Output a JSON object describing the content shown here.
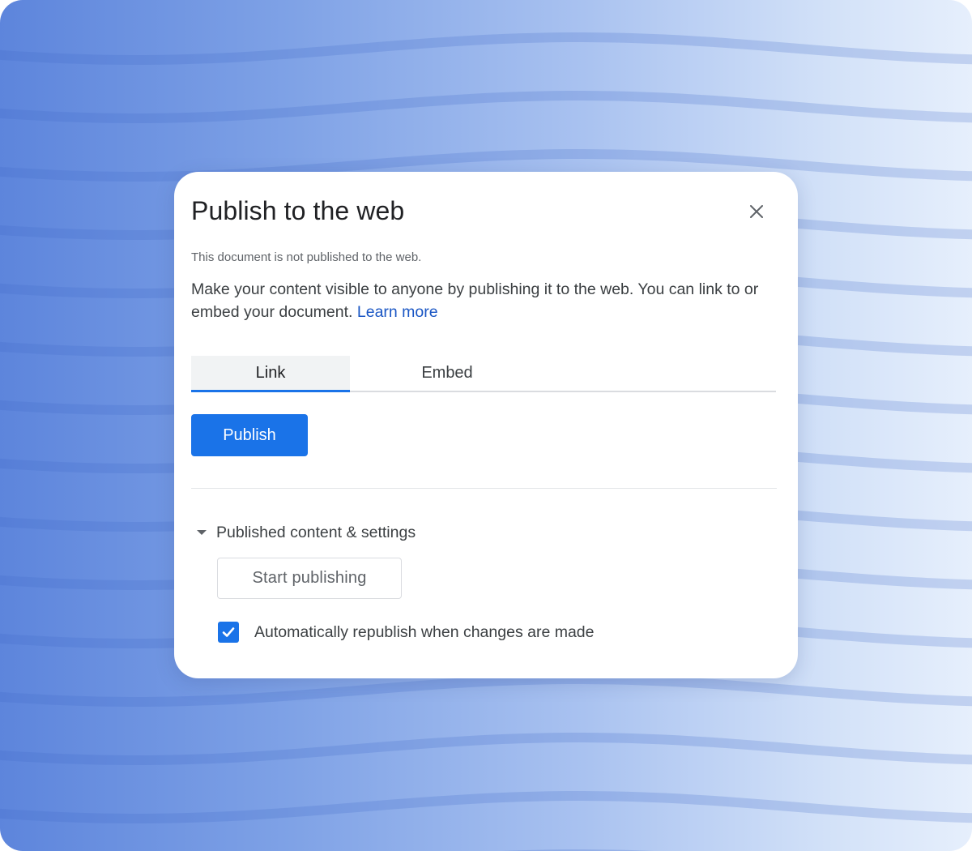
{
  "dialog": {
    "title": "Publish to the web",
    "close_icon": "close-icon",
    "status_text": "This document is not published to the web.",
    "description": "Make your content visible to anyone by publishing it to the web. You can link to or embed your document.",
    "learn_more_label": "Learn more"
  },
  "tabs": [
    {
      "label": "Link",
      "selected": true
    },
    {
      "label": "Embed",
      "selected": false
    }
  ],
  "publish_button_label": "Publish",
  "section": {
    "label": "Published content & settings",
    "expanded": true,
    "caret_icon": "caret-down-icon",
    "start_button_label": "Start publishing",
    "checkbox": {
      "label": "Automatically republish when changes are made",
      "checked": true,
      "icon": "checkmark-icon"
    }
  },
  "colors": {
    "accent": "#1a73e8",
    "link": "#1a56c4",
    "background_left": "#5d85dc",
    "background_right": "#e6effc"
  }
}
